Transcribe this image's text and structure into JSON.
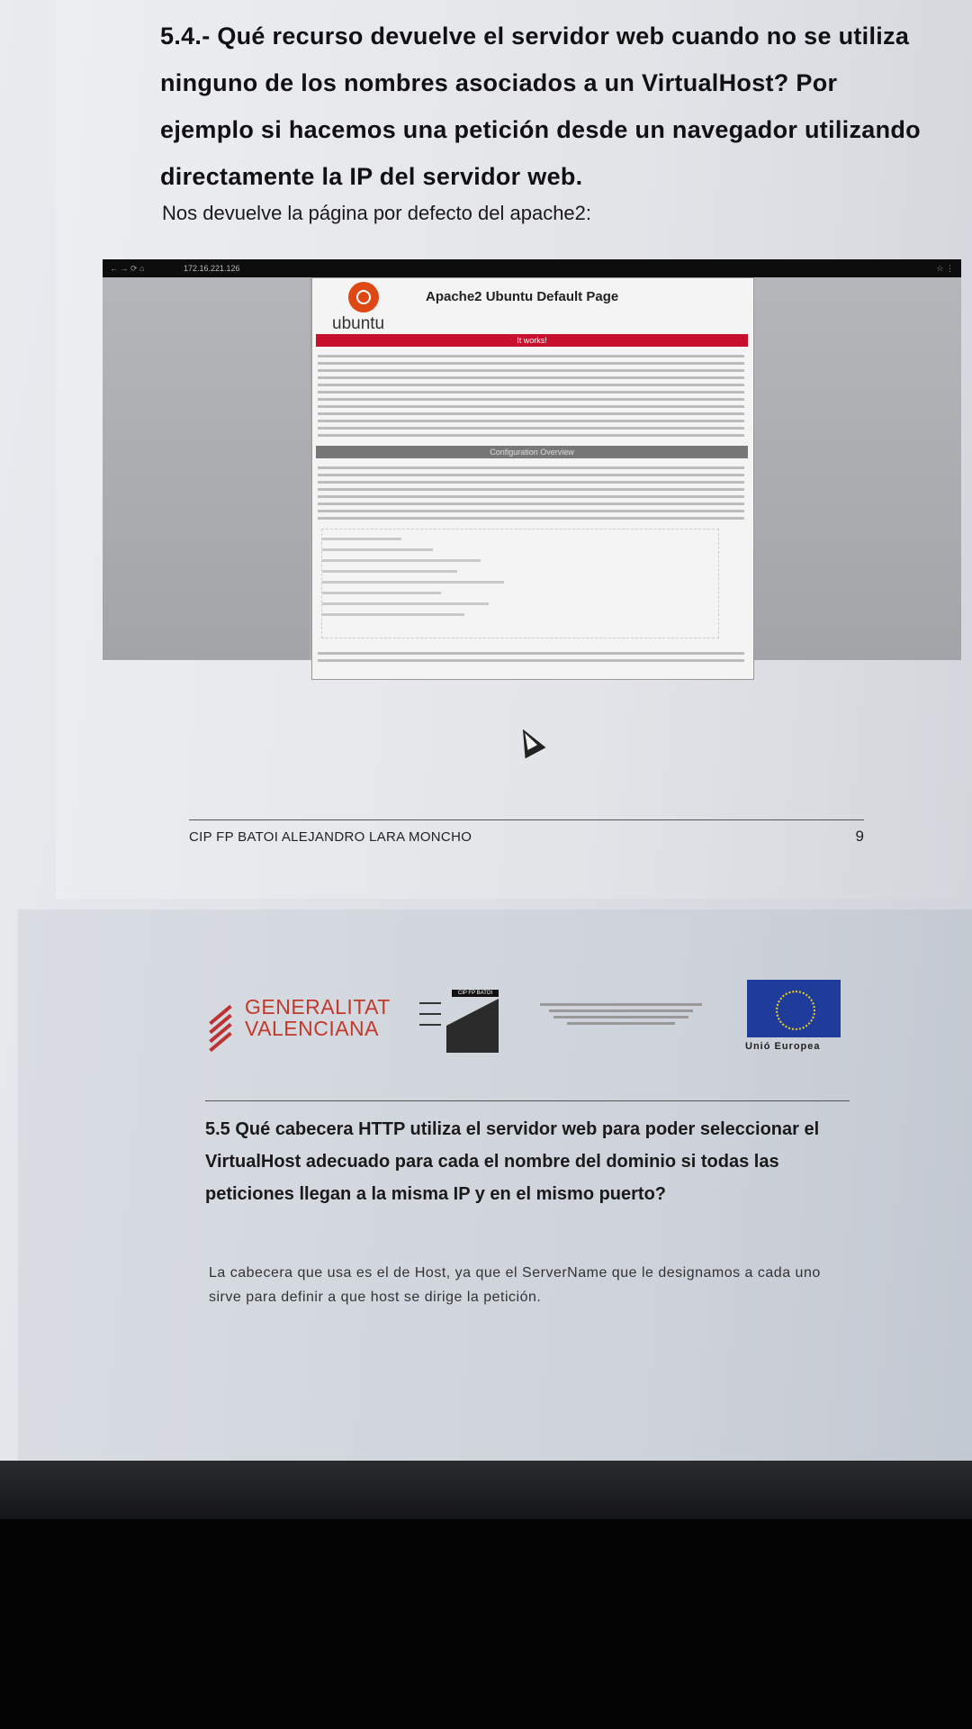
{
  "question_1": {
    "text": "5.4.- Qué recurso devuelve el servidor web cuando no se utiliza ninguno de los nombres asociados a un VirtualHost? Por ejemplo si hacemos una petición desde un navegador utilizando directamente la IP del servidor web.",
    "answer": "Nos devuelve la página por defecto del apache2:"
  },
  "embedded_screenshot": {
    "url": "172.16.221.126",
    "page_title": "Apache2 Ubuntu Default Page",
    "logo_word": "ubuntu",
    "banner_works": "It works!",
    "banner_config": "Configuration Overview"
  },
  "footer": {
    "left": "CIP FP BATOI    ALEJANDRO LARA MONCHO",
    "page_number": "9"
  },
  "logos": {
    "generalitat_line1": "GENERALITAT",
    "generalitat_line2": "VALENCIANA",
    "batoi_label": "CIP FP BATOI",
    "eu_label": "Unió Europea"
  },
  "question_2": {
    "text": "5.5 Qué cabecera HTTP utiliza el servidor web para poder seleccionar el VirtualHost adecuado para cada el nombre del dominio si todas las peticiones llegan a la misma IP y en el mismo puerto?",
    "answer": "La cabecera que usa es el de Host, ya que el ServerName que le designamos a cada uno sirve para definir a que host se dirige la petición."
  },
  "colors": {
    "ubuntu_orange": "#dd4814",
    "works_red": "#c8102e",
    "generalitat_red": "#c0392b",
    "eu_blue": "#1f3c9a"
  }
}
